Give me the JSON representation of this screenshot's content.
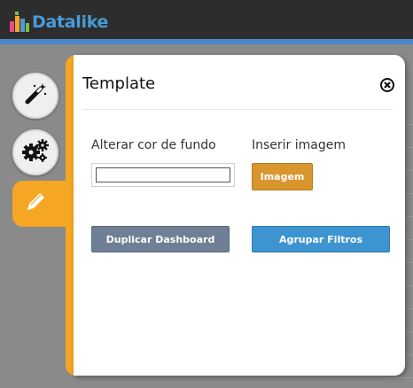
{
  "app": {
    "logo_text": "Datalike",
    "colors": {
      "accent": "#f5a623",
      "topbar": "#2d2d2d",
      "stripe": "#4a88c7",
      "logo": "#4a9bd8"
    }
  },
  "sidebar": {
    "items": [
      {
        "icon": "magic-wand-icon"
      },
      {
        "icon": "gears-icon"
      },
      {
        "icon": "pencil-icon",
        "active": true
      }
    ]
  },
  "panel": {
    "title": "Template",
    "background_label": "Alterar cor de fundo",
    "background_value": "",
    "image_label": "Inserir imagem",
    "image_button": "Imagem",
    "duplicate_button": "Duplicar Dashboard",
    "group_button": "Agrupar Filtros"
  }
}
